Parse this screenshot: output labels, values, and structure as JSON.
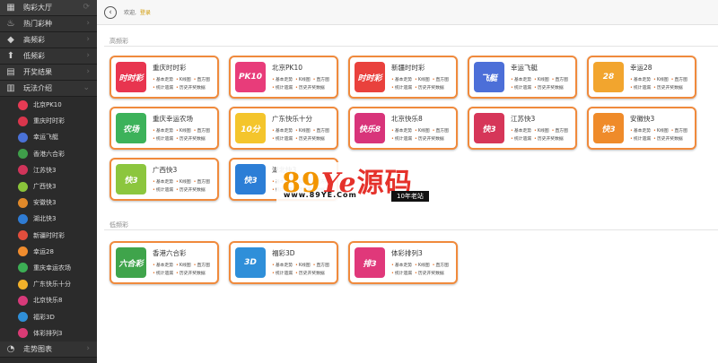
{
  "sidebar": {
    "menu": [
      {
        "label": "购彩大厅",
        "icon": "grid-icon",
        "chevron": "⟳"
      },
      {
        "label": "热门彩种",
        "icon": "flame-icon",
        "chevron": "›"
      },
      {
        "label": "高频彩",
        "icon": "droplet-icon",
        "chevron": "›"
      },
      {
        "label": "低频彩",
        "icon": "trend-icon",
        "chevron": "›"
      },
      {
        "label": "开奖结果",
        "icon": "calendar-icon",
        "chevron": "›"
      },
      {
        "label": "玩法介绍",
        "icon": "book-icon",
        "chevron": "⌄"
      }
    ],
    "sub_items": [
      {
        "label": "北京PK10",
        "color": "#e53b54"
      },
      {
        "label": "重庆时时彩",
        "color": "#d9364c"
      },
      {
        "label": "幸运飞艇",
        "color": "#4a72d8"
      },
      {
        "label": "香港六合彩",
        "color": "#3f9e4a"
      },
      {
        "label": "江苏快3",
        "color": "#d1345a"
      },
      {
        "label": "广西快3",
        "color": "#8ac43a"
      },
      {
        "label": "安徽快3",
        "color": "#e0892a"
      },
      {
        "label": "湖北快3",
        "color": "#2f7cd4"
      },
      {
        "label": "新疆时时彩",
        "color": "#e24d3c"
      },
      {
        "label": "幸运28",
        "color": "#f08c2e"
      },
      {
        "label": "重庆幸运农场",
        "color": "#3cae54"
      },
      {
        "label": "广东快乐十分",
        "color": "#f2b12a"
      },
      {
        "label": "北京快乐8",
        "color": "#d73a7a"
      },
      {
        "label": "福彩3D",
        "color": "#2f8fd8"
      },
      {
        "label": "体彩排列3",
        "color": "#d93b75"
      }
    ],
    "footer": {
      "label": "走势图表",
      "icon": "chart-icon",
      "chevron": "›"
    }
  },
  "topbar": {
    "greeting": "欢迎,",
    "login": "登录"
  },
  "sections": {
    "high": "高频彩",
    "low": "低频彩"
  },
  "card_links": [
    "基本走势",
    "K线图",
    "直方图",
    "统计遗漏",
    "历史开奖数据"
  ],
  "high_cards": [
    {
      "name": "重庆时时彩",
      "logo": "时时彩",
      "color": "#e8354f"
    },
    {
      "name": "北京PK10",
      "logo": "PK10",
      "color": "#e83c7a"
    },
    {
      "name": "新疆时时彩",
      "logo": "时时彩",
      "color": "#e9413d"
    },
    {
      "name": "幸运飞艇",
      "logo": "飞艇",
      "color": "#4c6fd8"
    },
    {
      "name": "幸运28",
      "logo": "28",
      "color": "#f2a52e"
    },
    {
      "name": "重庆幸运农场",
      "logo": "农场",
      "color": "#3cb25a"
    },
    {
      "name": "广东快乐十分",
      "logo": "10分",
      "color": "#f4c52c"
    },
    {
      "name": "北京快乐8",
      "logo": "快乐8",
      "color": "#d8347a"
    },
    {
      "name": "江苏快3",
      "logo": "快3",
      "color": "#d63659"
    },
    {
      "name": "安徽快3",
      "logo": "快3",
      "color": "#ef8b2a"
    },
    {
      "name": "广西快3",
      "logo": "快3",
      "color": "#8cc63e"
    },
    {
      "name": "湖北快3",
      "logo": "快3",
      "color": "#2c7ed6"
    }
  ],
  "low_cards": [
    {
      "name": "香港六合彩",
      "logo": "六合彩",
      "color": "#3fa44b"
    },
    {
      "name": "福彩3D",
      "logo": "3D",
      "color": "#2f8fd9"
    },
    {
      "name": "体彩排列3",
      "logo": "排3",
      "color": "#e0387a"
    }
  ],
  "watermark": {
    "num": "89",
    "ye": "Ye",
    "src": "源码",
    "url": "www.89YE.Com",
    "tag": "10年老站"
  }
}
